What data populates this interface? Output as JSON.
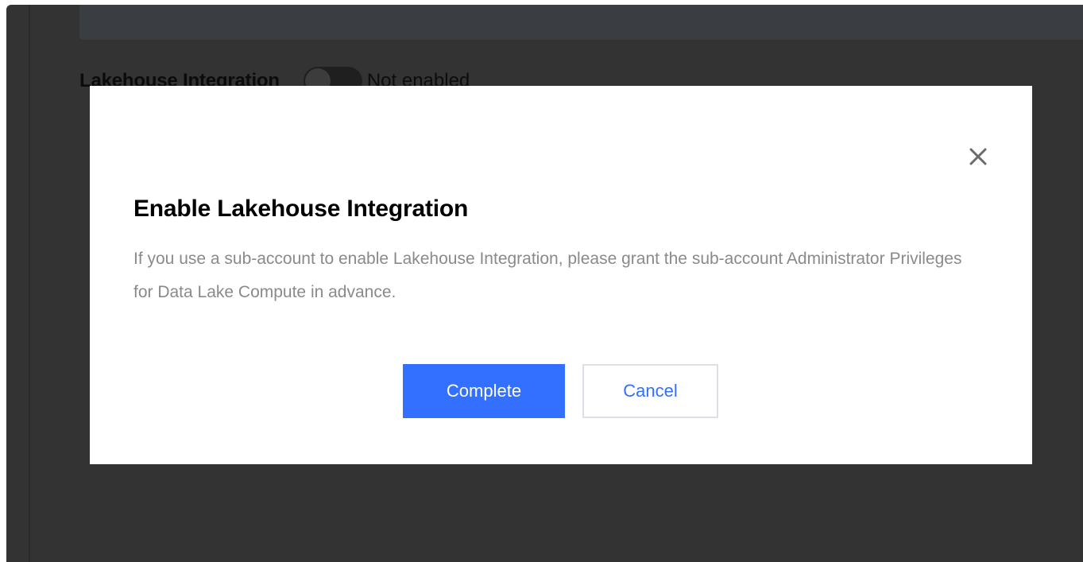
{
  "background": {
    "integration_label": "Lakehouse Integration",
    "toggle_enabled": false,
    "toggle_status": "Not enabled"
  },
  "modal": {
    "title": "Enable Lakehouse Integration",
    "description": "If you use a sub-account to enable Lakehouse Integration, please grant the sub-account Administrator Privileges for Data Lake Compute in advance.",
    "buttons": {
      "complete_label": "Complete",
      "cancel_label": "Cancel"
    },
    "close_icon": "close-icon"
  },
  "colors": {
    "accent": "#3370ff",
    "overlay": "#333333",
    "description_text": "#8a8a8a"
  }
}
